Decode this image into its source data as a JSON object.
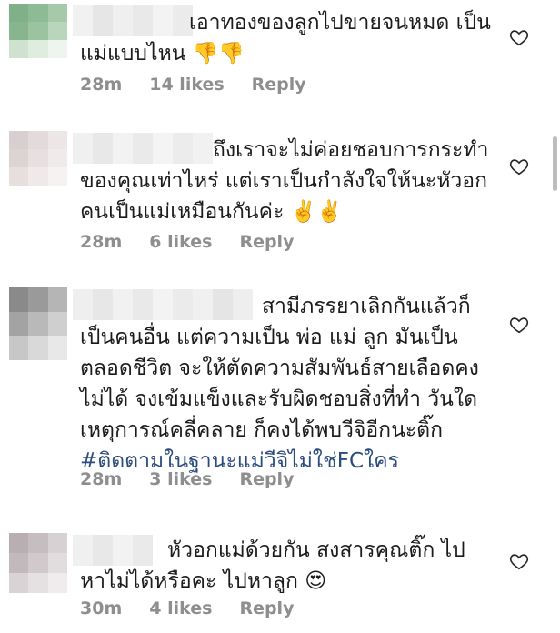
{
  "comments": [
    {
      "text": "เอาทองของลูกไปขายจนหมด เป็น\nแม่แบบไหน 👎👎",
      "time": "28m",
      "likes": "14 likes",
      "reply": "Reply"
    },
    {
      "text": "ถึงเราจะไม่ค่อยชอบการกระทำ\nของคุณเท่าไหร่ แต่เราเป็นกำลังใจให้นะหัวอก\nคนเป็นแม่เหมือนกันค่ะ ✌️✌️",
      "time": "28m",
      "likes": "6 likes",
      "reply": "Reply"
    },
    {
      "text": "สามีภรรยาเลิกกันแล้วก็\nเป็นคนอื่น แต่ความเป็น พ่อ แม่ ลูก มันเป็น\nตลอดชีวิต จะให้ตัดความสัมพันธ์สายเลือดคง\nไม่ได้ จงเข้มแข็งและรับผิดชอบสิ่งที่ทำ วันใด\nเหตุการณ์คลี่คลาย ก็คงได้พบวีจิอีกนะติ๊ก",
      "hashtag": "#ติดตามในฐานะแม่วีจิไม่ใช่FCใคร",
      "time": "28m",
      "likes": "3 likes",
      "reply": "Reply"
    },
    {
      "text": "หัวอกแม่ด้วยกัน สงสารคุณติ๊ก ไป\nหาไม่ได้หรือคะ ไปหาลูก 😍",
      "time": "30m",
      "likes": "4 likes",
      "reply": "Reply"
    }
  ],
  "icons": {
    "like": "heart-outline-icon"
  },
  "colors": {
    "meta": "#8e8e8e",
    "hashtag": "#2a4b7c",
    "text": "#1b1b1b"
  }
}
